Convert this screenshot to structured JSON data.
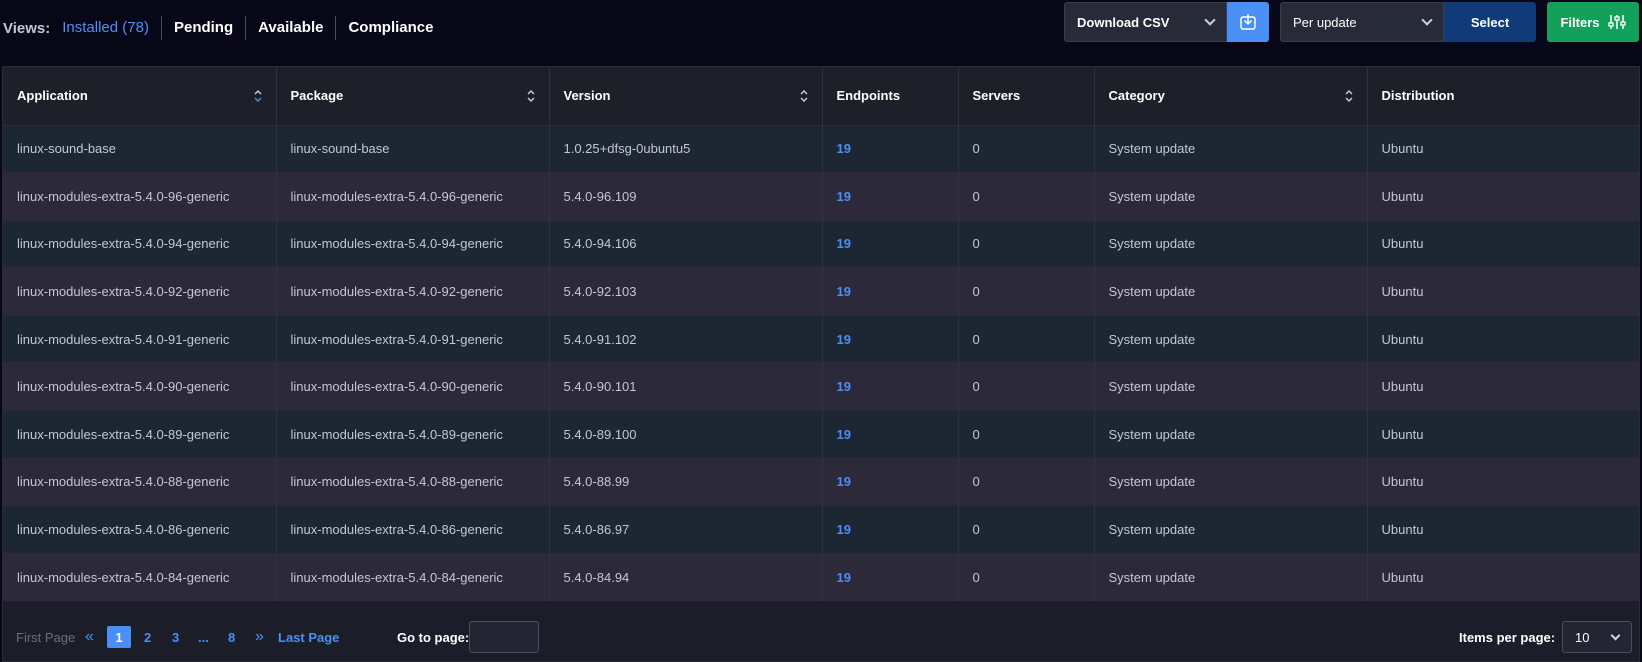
{
  "views": {
    "label": "Views:",
    "tabs": [
      "Installed (78)",
      "Pending",
      "Available",
      "Compliance"
    ],
    "active": "Installed (78)"
  },
  "toolbar": {
    "download_select": "Download CSV",
    "per_update_select": "Per update",
    "select_label": "Select",
    "filters_label": "Filters"
  },
  "table": {
    "columns": [
      "Application",
      "Package",
      "Version",
      "Endpoints",
      "Servers",
      "Category",
      "Distribution"
    ],
    "rows": [
      [
        "linux-sound-base",
        "linux-sound-base",
        "1.0.25+dfsg-0ubuntu5",
        "19",
        "0",
        "System update",
        "Ubuntu"
      ],
      [
        "linux-modules-extra-5.4.0-96-generic",
        "linux-modules-extra-5.4.0-96-generic",
        "5.4.0-96.109",
        "19",
        "0",
        "System update",
        "Ubuntu"
      ],
      [
        "linux-modules-extra-5.4.0-94-generic",
        "linux-modules-extra-5.4.0-94-generic",
        "5.4.0-94.106",
        "19",
        "0",
        "System update",
        "Ubuntu"
      ],
      [
        "linux-modules-extra-5.4.0-92-generic",
        "linux-modules-extra-5.4.0-92-generic",
        "5.4.0-92.103",
        "19",
        "0",
        "System update",
        "Ubuntu"
      ],
      [
        "linux-modules-extra-5.4.0-91-generic",
        "linux-modules-extra-5.4.0-91-generic",
        "5.4.0-91.102",
        "19",
        "0",
        "System update",
        "Ubuntu"
      ],
      [
        "linux-modules-extra-5.4.0-90-generic",
        "linux-modules-extra-5.4.0-90-generic",
        "5.4.0-90.101",
        "19",
        "0",
        "System update",
        "Ubuntu"
      ],
      [
        "linux-modules-extra-5.4.0-89-generic",
        "linux-modules-extra-5.4.0-89-generic",
        "5.4.0-89.100",
        "19",
        "0",
        "System update",
        "Ubuntu"
      ],
      [
        "linux-modules-extra-5.4.0-88-generic",
        "linux-modules-extra-5.4.0-88-generic",
        "5.4.0-88.99",
        "19",
        "0",
        "System update",
        "Ubuntu"
      ],
      [
        "linux-modules-extra-5.4.0-86-generic",
        "linux-modules-extra-5.4.0-86-generic",
        "5.4.0-86.97",
        "19",
        "0",
        "System update",
        "Ubuntu"
      ],
      [
        "linux-modules-extra-5.4.0-84-generic",
        "linux-modules-extra-5.4.0-84-generic",
        "5.4.0-84.94",
        "19",
        "0",
        "System update",
        "Ubuntu"
      ]
    ]
  },
  "pagination": {
    "first_label": "First Page",
    "pages": [
      "1",
      "2",
      "3",
      "...",
      "8"
    ],
    "current_page": "1",
    "last_label": "Last Page",
    "goto_label": "Go to page:",
    "goto_value": "",
    "items_per_page_label": "Items per page:",
    "items_per_page": "10"
  },
  "colors": {
    "accent": "#4a8ff6",
    "filters": "#12a05a",
    "select": "#103a78"
  }
}
